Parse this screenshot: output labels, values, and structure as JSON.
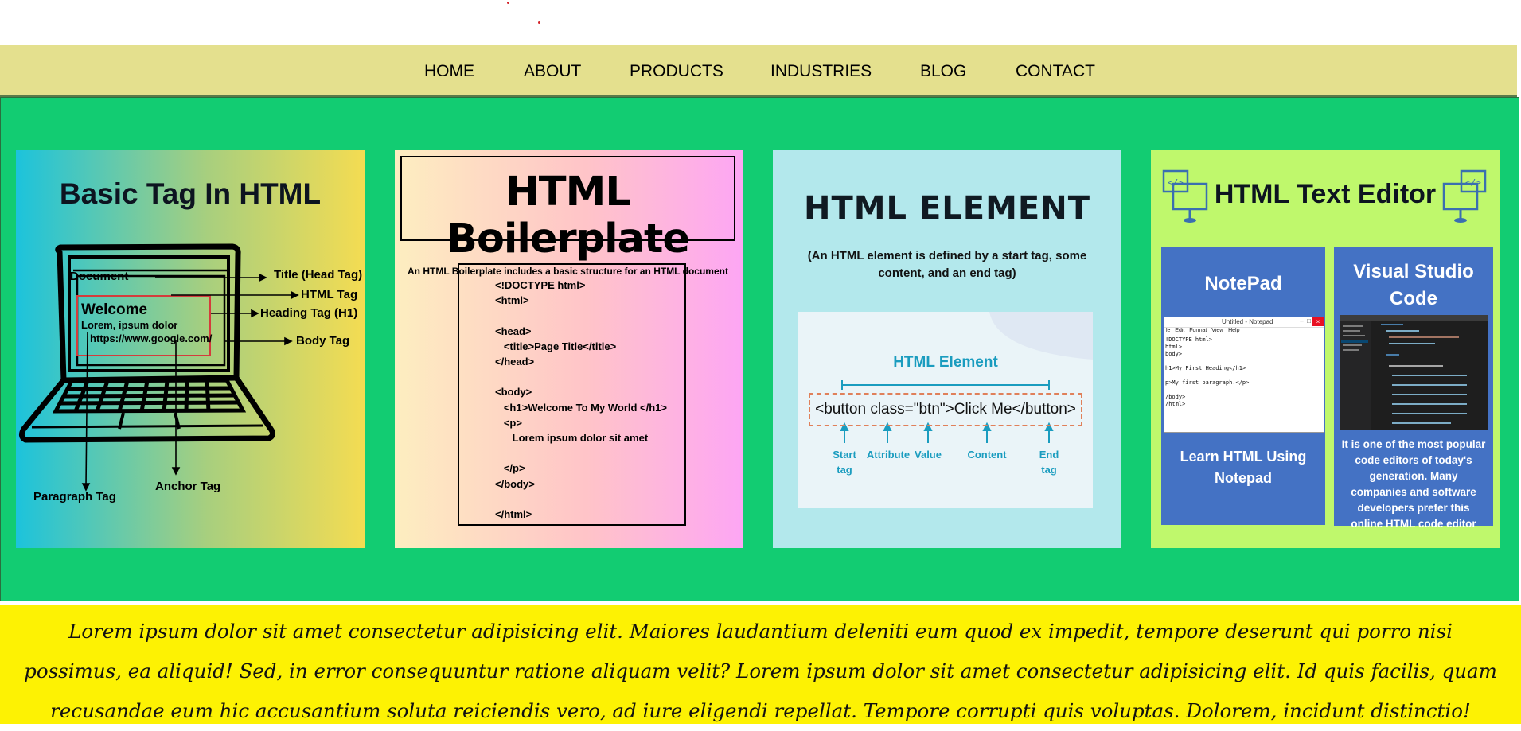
{
  "nav": {
    "items": [
      "HOME",
      "ABOUT",
      "PRODUCTS",
      "INDUSTRIES",
      "BLOG",
      "CONTACT"
    ]
  },
  "cards": [
    {
      "title": "Basic Tag In HTML",
      "screen_title": "Document",
      "screen_heading": "Welcome",
      "screen_para": "Lorem, ipsum dolor",
      "screen_link": "https://www.google.com/",
      "labels": {
        "title": "Title (Head Tag)",
        "html": "HTML Tag",
        "heading": "Heading Tag (H1)",
        "body": "Body Tag",
        "paragraph": "Paragraph Tag",
        "anchor": "Anchor Tag"
      }
    },
    {
      "title": "HTML Boilerplate",
      "subtitle": "An HTML Boilerplate includes a basic structure for an HTML document",
      "code": [
        "<!DOCTYPE html>",
        "<html>",
        "",
        "<head>",
        "   <title>Page Title</title>",
        "</head>",
        "",
        "<body>",
        "   <h1>Welcome To My World </h1>",
        "   <p>",
        "      Lorem ipsum dolor sit amet",
        "",
        "   </p>",
        "</body>",
        "",
        "</html>"
      ]
    },
    {
      "title": "HTML ELEMENT",
      "subtitle": "(An HTML element is defined by a start tag, some content, and an end tag)",
      "panel_title": "HTML Element",
      "code_example": "<button class=\"btn\">Click Me</button>",
      "annotations": [
        "Start tag",
        "Attribute",
        "Value",
        "Content",
        "End tag"
      ]
    },
    {
      "title": "HTML Text Editor",
      "notepad": {
        "title": "NotePad",
        "window_title": "Untitled - Notepad",
        "menu": [
          "le",
          "Edit",
          "Format",
          "View",
          "Help"
        ],
        "lines": [
          "!DOCTYPE html>",
          "html>",
          "body>",
          "",
          "h1>My First Heading</h1>",
          "",
          "p>My first paragraph.</p>",
          "",
          "/body>",
          "/html>"
        ],
        "caption": "Learn HTML Using Notepad"
      },
      "vscode": {
        "title": "Visual Studio Code",
        "caption": "It is one of the most popular code editors of today's generation. Many companies and software developers prefer this online HTML code editor"
      }
    }
  ],
  "footer": {
    "text": "Lorem ipsum dolor sit amet consectetur adipisicing elit. Maiores laudantium deleniti eum quod ex impedit, tempore deserunt qui porro nisi possimus, ea aliquid! Sed, in error consequuntur ratione aliquam velit? Lorem ipsum dolor sit amet consectetur adipisicing elit. Id quis facilis, quam recusandae eum hic accusantium soluta reiciendis vero, ad iure eligendi repellat. Tempore corrupti quis voluptas. Dolorem, incidunt distinctio!"
  },
  "colors": {
    "nav_bg": "#e4e08e",
    "section_bg": "#12cc72",
    "footer_bg": "#fdf203",
    "editor_blue": "#4472c4"
  }
}
